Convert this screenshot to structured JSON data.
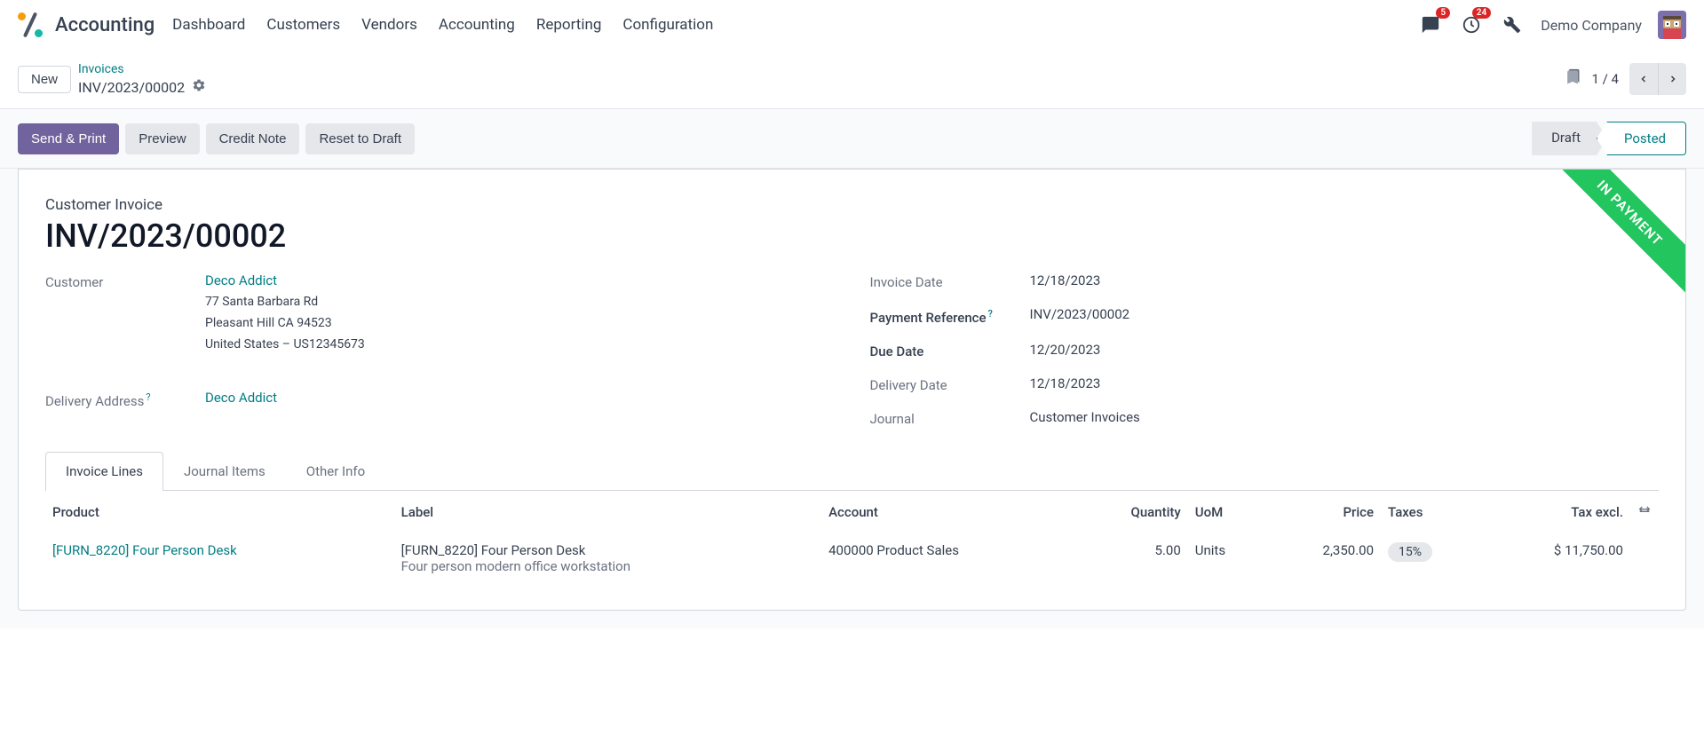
{
  "nav": {
    "title": "Accounting",
    "items": [
      "Dashboard",
      "Customers",
      "Vendors",
      "Accounting",
      "Reporting",
      "Configuration"
    ],
    "badges": {
      "messages": "5",
      "activities": "24"
    },
    "company": "Demo Company"
  },
  "controls": {
    "new_label": "New",
    "breadcrumb_link": "Invoices",
    "breadcrumb_current": "INV/2023/00002",
    "pager": "1 / 4"
  },
  "actions": {
    "send_print": "Send & Print",
    "preview": "Preview",
    "credit_note": "Credit Note",
    "reset_draft": "Reset to Draft",
    "status_draft": "Draft",
    "status_posted": "Posted"
  },
  "doc": {
    "label": "Customer Invoice",
    "title": "INV/2023/00002",
    "ribbon": "IN PAYMENT",
    "fields": {
      "customer_label": "Customer",
      "customer": "Deco Addict",
      "address_street": "77 Santa Barbara Rd",
      "address_city": "Pleasant Hill CA 94523",
      "address_country": "United States – US12345673",
      "delivery_address_label": "Delivery Address",
      "delivery_address": "Deco Addict",
      "invoice_date_label": "Invoice Date",
      "invoice_date": "12/18/2023",
      "payment_ref_label": "Payment Reference",
      "payment_ref": "INV/2023/00002",
      "due_date_label": "Due Date",
      "due_date": "12/20/2023",
      "delivery_date_label": "Delivery Date",
      "delivery_date": "12/18/2023",
      "journal_label": "Journal",
      "journal": "Customer Invoices"
    }
  },
  "tabs": {
    "invoice_lines": "Invoice Lines",
    "journal_items": "Journal Items",
    "other_info": "Other Info"
  },
  "table": {
    "headers": {
      "product": "Product",
      "label": "Label",
      "account": "Account",
      "quantity": "Quantity",
      "uom": "UoM",
      "price": "Price",
      "taxes": "Taxes",
      "tax_excl": "Tax excl."
    },
    "rows": [
      {
        "product": "[FURN_8220] Four Person Desk",
        "label_line1": "[FURN_8220] Four Person Desk",
        "label_line2": "Four person modern office workstation",
        "account": "400000 Product Sales",
        "quantity": "5.00",
        "uom": "Units",
        "price": "2,350.00",
        "tax": "15%",
        "tax_excl": "$ 11,750.00"
      }
    ]
  }
}
